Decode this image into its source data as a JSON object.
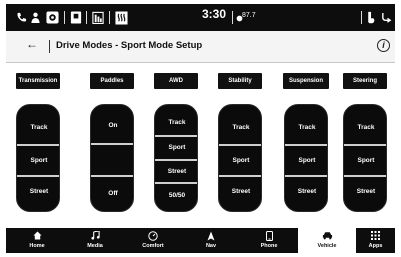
{
  "statusbar": {
    "time": "3:30",
    "temperature": "87.7",
    "icons": [
      "phone-icon",
      "driver-icon",
      "camera-icon",
      "seat-icon",
      "battery-icon",
      "seat-heat-icon",
      "volume-icon",
      "steering-heat-icon"
    ]
  },
  "header": {
    "back_icon": "←",
    "title": "Drive Modes - Sport Mode Setup",
    "info_icon": "i"
  },
  "categories": [
    "Transmission",
    "Paddles",
    "AWD",
    "Stability",
    "Suspension",
    "Steering"
  ],
  "selectors": {
    "transmission": [
      "Track",
      "Sport",
      "Street"
    ],
    "paddles": [
      "On",
      "Off"
    ],
    "awd": [
      "Track",
      "Sport",
      "Street",
      "50/50"
    ],
    "stability": [
      "Track",
      "Sport",
      "Street"
    ],
    "suspension": [
      "Track",
      "Sport",
      "Street"
    ],
    "steering": [
      "Track",
      "Sport",
      "Street"
    ]
  },
  "nav": [
    {
      "label": "Home",
      "icon": "home-icon"
    },
    {
      "label": "Media",
      "icon": "music-icon"
    },
    {
      "label": "Comfort",
      "icon": "comfort-icon"
    },
    {
      "label": "Nav",
      "icon": "nav-icon"
    },
    {
      "label": "Phone",
      "icon": "phone-icon"
    },
    {
      "label": "Vehicle",
      "icon": "car-icon"
    },
    {
      "label": "Apps",
      "icon": "apps-icon"
    }
  ],
  "active_nav": "Vehicle"
}
